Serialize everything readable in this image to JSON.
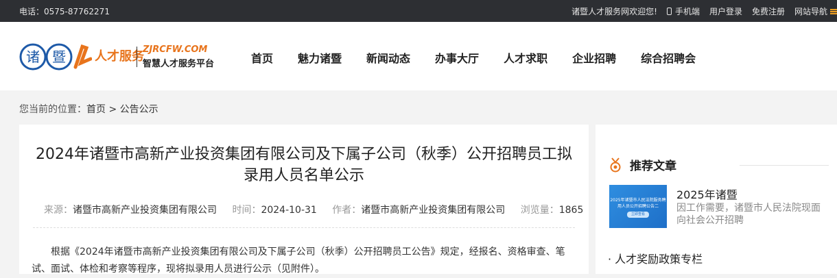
{
  "topbar": {
    "phone": "电话：0575-87762271",
    "welcome": "诸暨人才服务网欢迎您!",
    "mobile": "手机端",
    "login": "用户登录",
    "register": "免费注册",
    "site_nav": "网站导航"
  },
  "logo": {
    "seal_chars": [
      "诸",
      "暨"
    ],
    "brand": "人才服务",
    "domain": "ZJRCFW.COM",
    "slogan": "智慧人才服务平台"
  },
  "nav": [
    "首页",
    "魅力诸暨",
    "新闻动态",
    "办事大厅",
    "人才求职",
    "企业招聘",
    "综合招聘会"
  ],
  "breadcrumb": {
    "prefix": "您当前的位置：",
    "home": "首页",
    "sep": ">",
    "current": "公告公示"
  },
  "article": {
    "title": "2024年诸暨市高新产业投资集团有限公司及下属子公司（秋季）公开招聘员工拟录用人员名单公示",
    "source_label": "来源：",
    "source": "诸暨市高新产业投资集团有限公司",
    "time_label": "时间：",
    "time": "2024-10-31",
    "author_label": "作者：",
    "author": "诸暨市高新产业投资集团有限公司",
    "views_label": "浏览量：",
    "views": "1865",
    "body": "根据《2024年诸暨市高新产业投资集团有限公司及下属子公司（秋季）公开招聘员工公告》规定，经报名、资格审查、笔试、面试、体检和考察等程序，现将拟录用人员进行公示（见附件）。"
  },
  "sidebar": {
    "title": "推荐文章",
    "rec_title": "2025年诸暨",
    "rec_desc": "因工作需要，诸暨市人民法院现面向社会公开招聘",
    "thumb_text": "2025年诸暨市人民法院服务聘用人员公开招聘公告二",
    "thumb_pill": "立即查看",
    "policy": "· 人才奖励政策专栏"
  }
}
